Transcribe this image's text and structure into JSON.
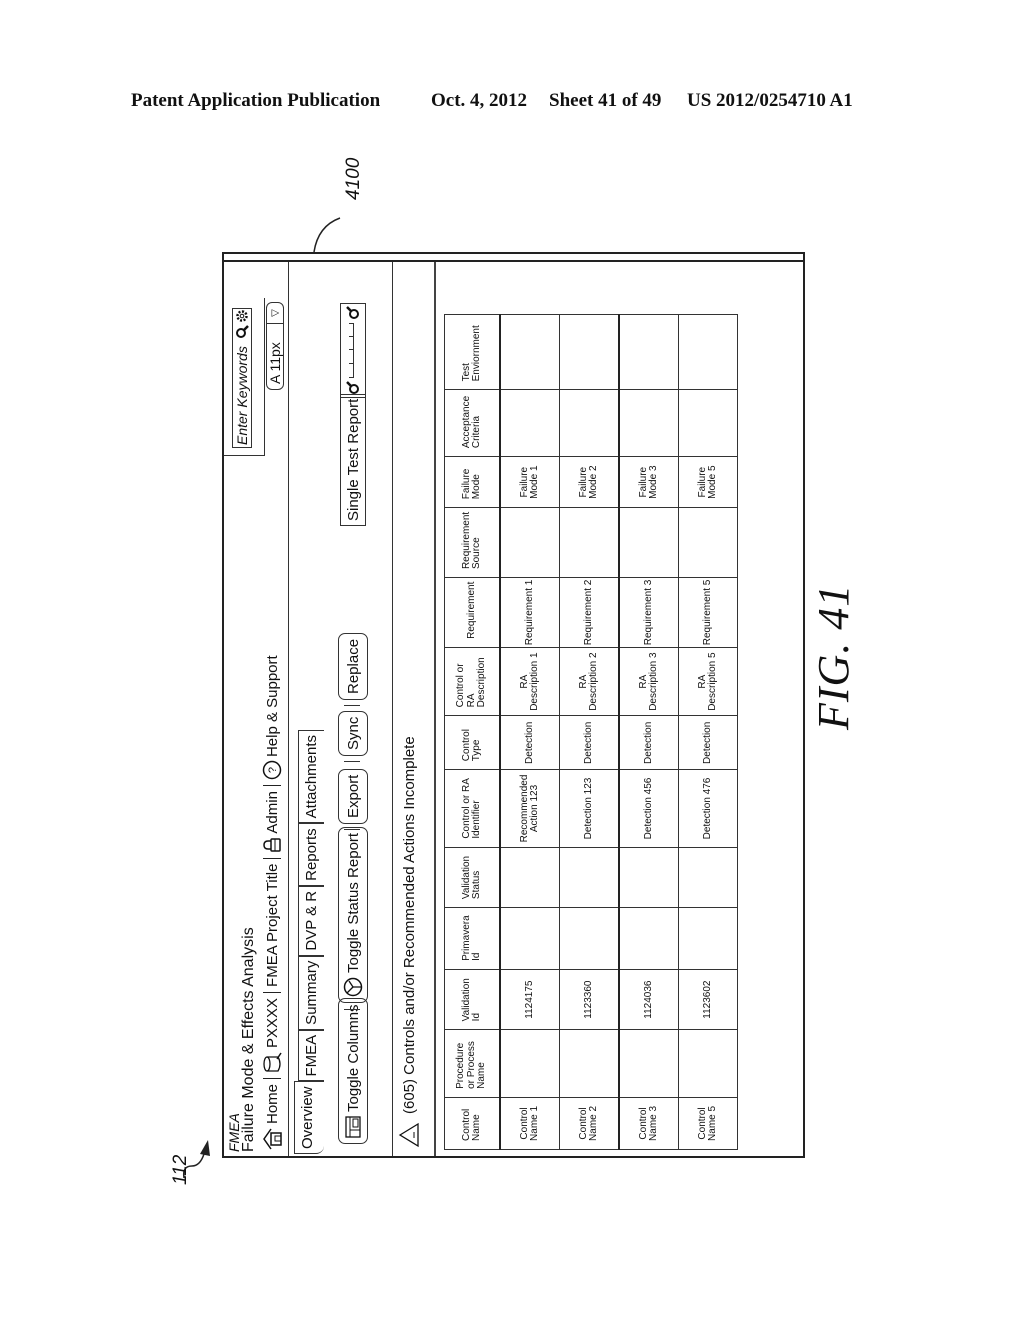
{
  "page_header": {
    "left": "Patent Application Publication",
    "date": "Oct. 4, 2012",
    "sheet": "Sheet 41 of 49",
    "number": "US 2012/0254710 A1"
  },
  "references": {
    "figure_ref": "4100",
    "ui_ref": "112"
  },
  "figure_caption": "FIG. 41",
  "app": {
    "short_title": "FMEA",
    "long_title": "Failure Mode & Effects Analysis",
    "search": {
      "placeholder": "Enter Keywords"
    },
    "nav": [
      {
        "label": "Home",
        "icon": "home-icon"
      },
      {
        "label": "PXXXX",
        "icon": "database-icon"
      },
      {
        "label": "FMEA Project Title",
        "icon": ""
      },
      {
        "label": "Admin",
        "icon": "lock-icon"
      },
      {
        "label": "Help & Support",
        "icon": "help-icon"
      }
    ],
    "font_size_select": {
      "value": "A 11px"
    },
    "tabs": [
      {
        "label": "Overview",
        "active": true
      },
      {
        "label": "FMEA",
        "active": false
      },
      {
        "label": "Summary",
        "active": false
      },
      {
        "label": "DVP & R",
        "active": false
      },
      {
        "label": "Reports",
        "active": false
      },
      {
        "label": "Attachments",
        "active": false
      }
    ],
    "toolbar": {
      "toggle_columns": "Toggle Columns",
      "toggle_status_report": "Toggle Status Report",
      "export": "Export",
      "sync": "Sync",
      "replace": "Replace",
      "single_test_report": "Single Test Report"
    },
    "alert": {
      "text": "(605) Controls and/or Recommended Actions Incomplete"
    },
    "table": {
      "columns": [
        "Control Name",
        "Procedure or Process Name",
        "Validation Id",
        "Primavera Id",
        "Validation Status",
        "Control or RA Identifier",
        "Control Type",
        "Control or RA Description",
        "Requirement",
        "Requirement Source",
        "Failure Mode",
        "Acceptance Criteria",
        "Test Enviornment"
      ],
      "rows": [
        [
          "Control Name 1",
          "",
          "1124175",
          "",
          "",
          "Recommended Action 123",
          "Detection",
          "RA Description 1",
          "Requirement 1",
          "",
          "Failure Mode 1",
          "",
          ""
        ],
        [
          "Control Name 2",
          "",
          "1123360",
          "",
          "",
          "Detection 123",
          "Detection",
          "RA Description 2",
          "Requirement 2",
          "",
          "Failure Mode 2",
          "",
          ""
        ],
        [
          "Control Name 3",
          "",
          "1124036",
          "",
          "",
          "Detection 456",
          "Detection",
          "RA Description 3",
          "Requirement 3",
          "",
          "Failure Mode 3",
          "",
          ""
        ],
        [
          "Control Name 5",
          "",
          "1123602",
          "",
          "",
          "Detection 476",
          "Detection",
          "RA Description 5",
          "Requirement 5",
          "",
          "Failure Mode 5",
          "",
          ""
        ]
      ]
    }
  }
}
